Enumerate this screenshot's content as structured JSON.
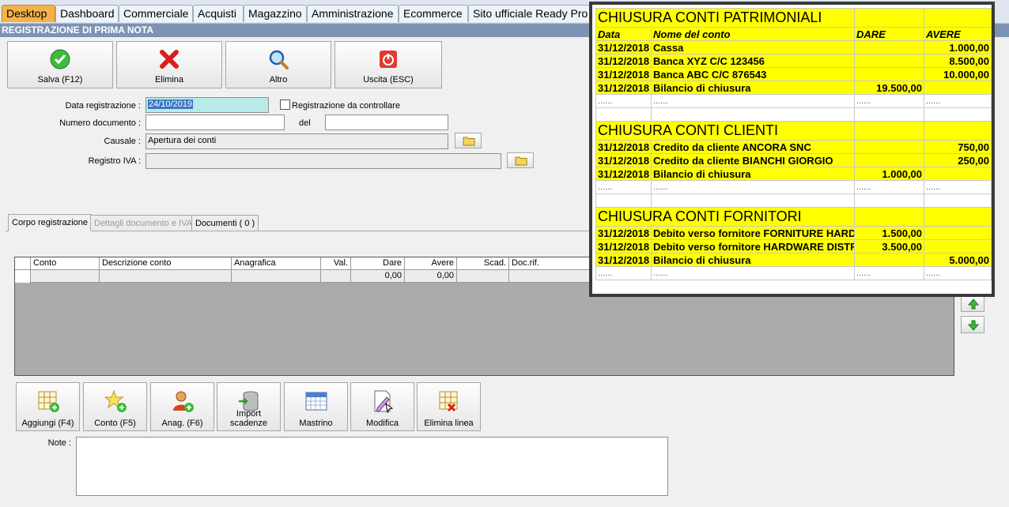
{
  "top_tabs": [
    "Desktop",
    "Dashboard",
    "Commerciale",
    "Acquisti",
    "Magazzino",
    "Amministrazione",
    "Ecommerce",
    "Sito ufficiale Ready Pro"
  ],
  "window_title": "REGISTRAZIONE DI PRIMA NOTA",
  "toolbar": {
    "save": "Salva (F12)",
    "delete": "Elimina",
    "other": "Altro",
    "exit": "Uscita (ESC)"
  },
  "form": {
    "date_label": "Data registrazione :",
    "date_value": "24/10/2019",
    "check_label": "Registrazione da controllare",
    "docnum_label": "Numero documento :",
    "docnum_value": "",
    "del_label": "del",
    "del_value": "",
    "causale_label": "Causale :",
    "causale_value": "Apertura dei conti",
    "iva_label": "Registro IVA :",
    "iva_value": ""
  },
  "inner_tabs": [
    "Corpo registrazione",
    "Dettagli documento e IVA",
    "Documenti ( 0 )"
  ],
  "grid": {
    "headers": [
      "Conto",
      "Descrizione conto",
      "Anagrafica",
      "Val.",
      "Dare",
      "Avere",
      "Scad.",
      "Doc.rif."
    ],
    "row": [
      "",
      "",
      "",
      "",
      "0,00",
      "0,00",
      "",
      ""
    ]
  },
  "bottom_buttons": [
    "Aggiungi (F4)",
    "Conto (F5)",
    "Anag. (F6)",
    "Import scadenze",
    "Mastrino",
    "Modifica",
    "Elimina linea"
  ],
  "notes_label": "Note :",
  "overlay": {
    "sections": [
      {
        "title": "CHIUSURA CONTI PATRIMONIALI",
        "columns": [
          "Data",
          "Nome del conto",
          "DARE",
          "AVERE"
        ],
        "rows": [
          [
            "31/12/2018",
            "Cassa",
            "",
            "1.000,00"
          ],
          [
            "31/12/2018",
            "Banca XYZ C/C 123456",
            "",
            "8.500,00"
          ],
          [
            "31/12/2018",
            "Banca ABC C/C 876543",
            "",
            "10.000,00"
          ],
          [
            "31/12/2018",
            "Bilancio di chiusura",
            "19.500,00",
            ""
          ]
        ]
      },
      {
        "title": "CHIUSURA CONTI CLIENTI",
        "rows": [
          [
            "31/12/2018",
            "Credito da cliente ANCORA SNC",
            "",
            "750,00"
          ],
          [
            "31/12/2018",
            "Credito da cliente BIANCHI GIORGIO",
            "",
            "250,00"
          ],
          [
            "31/12/2018",
            "Bilancio di chiusura",
            "1.000,00",
            ""
          ]
        ]
      },
      {
        "title": "CHIUSURA CONTI FORNITORI",
        "rows": [
          [
            "31/12/2018",
            "Debito verso fornitore FORNITURE HARDWARE",
            "1.500,00",
            ""
          ],
          [
            "31/12/2018",
            "Debito verso fornitore HARDWARE DISTRIBUTION",
            "3.500,00",
            ""
          ],
          [
            "31/12/2018",
            "Bilancio di chiusura",
            "",
            "5.000,00"
          ]
        ]
      }
    ],
    "dots": "......"
  },
  "colors": {
    "active_tab": "#f5b24a",
    "title_strip": "#7d93b3",
    "overlay_highlight": "#ffff00"
  }
}
